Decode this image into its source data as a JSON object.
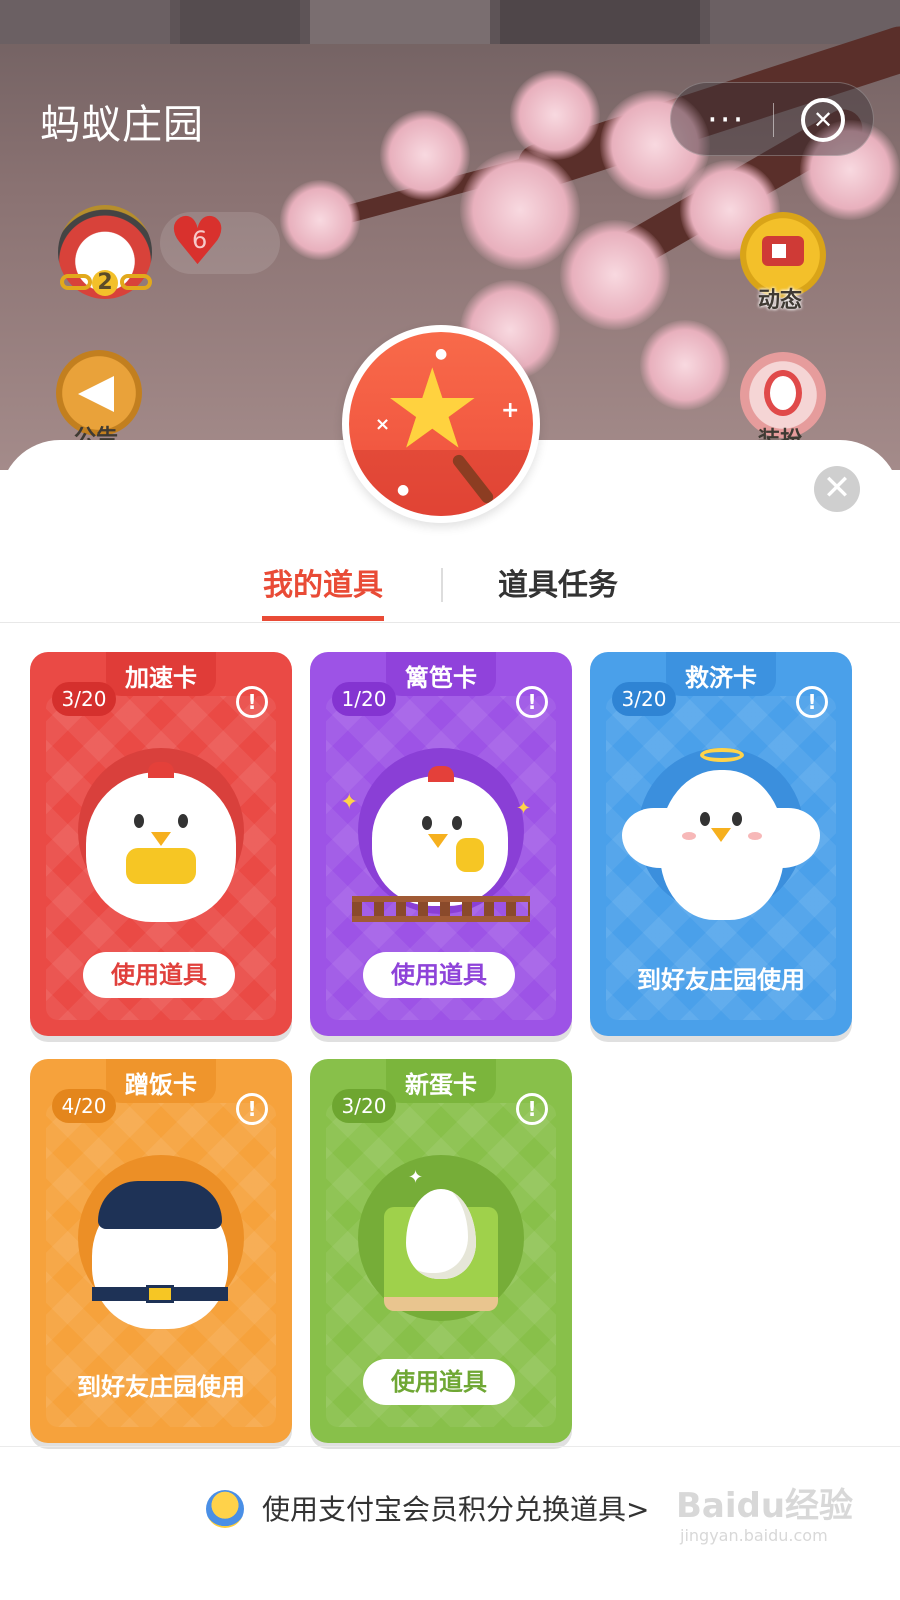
{
  "header": {
    "title": "蚂蚁庄园",
    "more_label": "···",
    "close_glyph": "✕"
  },
  "profile": {
    "rank": "2",
    "hearts": "6"
  },
  "side_buttons": {
    "dynamic": "动态",
    "notice": "公告",
    "dress": "装扮"
  },
  "panel": {
    "close_glyph": "✕",
    "tabs": [
      {
        "label": "我的道具",
        "active": true
      },
      {
        "label": "道具任务",
        "active": false
      }
    ]
  },
  "cards": [
    {
      "name": "加速卡",
      "count": "3/20",
      "action": "使用道具",
      "action_type": "button",
      "color": "#ea4a45"
    },
    {
      "name": "篱笆卡",
      "count": "1/20",
      "action": "使用道具",
      "action_type": "button",
      "color": "#9d53e6"
    },
    {
      "name": "救济卡",
      "count": "3/20",
      "action": "到好友庄园使用",
      "action_type": "text",
      "color": "#4aa0ea"
    },
    {
      "name": "蹭饭卡",
      "count": "4/20",
      "action": "到好友庄园使用",
      "action_type": "text",
      "color": "#f6a23c"
    },
    {
      "name": "新蛋卡",
      "count": "3/20",
      "action": "使用道具",
      "action_type": "button",
      "color": "#88c04a"
    }
  ],
  "info_glyph": "!",
  "footer": {
    "text": "使用支付宝会员积分兑换道具>",
    "icon": "coin-icon"
  },
  "watermark": {
    "text": "Baidu经验",
    "sub": "jingyan.baidu.com"
  }
}
